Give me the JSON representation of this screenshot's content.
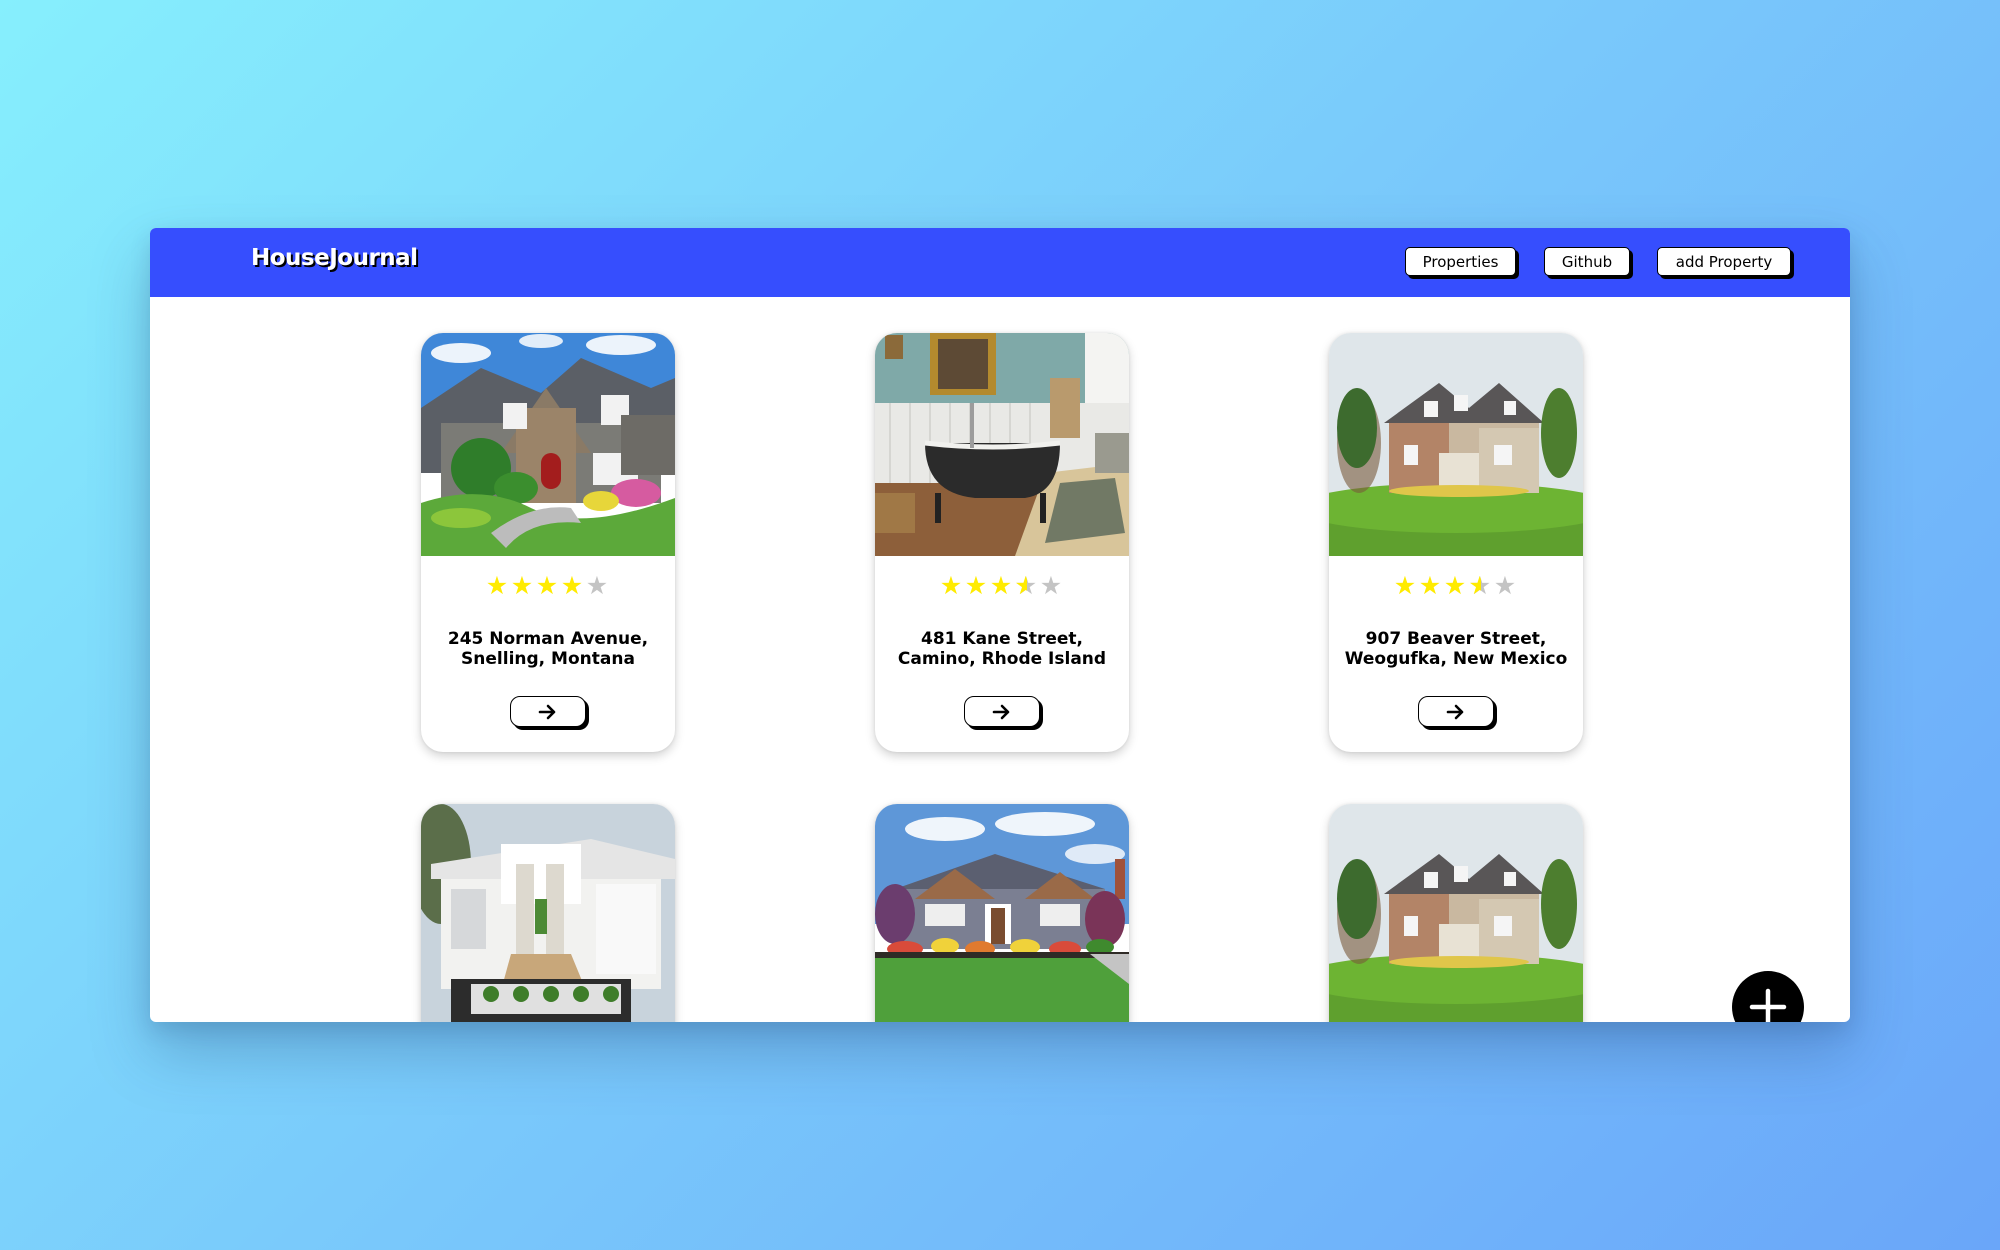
{
  "app": {
    "brand": "HouseJournal"
  },
  "nav": {
    "items": [
      {
        "label": "Properties"
      },
      {
        "label": "Github"
      },
      {
        "label": "add Property"
      }
    ]
  },
  "colors": {
    "navbar": "#364efe",
    "star_filled": "#ffeb00",
    "star_empty": "#c4c4c4",
    "fab": "#000000"
  },
  "properties": [
    {
      "image": "suburban-stone-house-photo",
      "rating": 4,
      "rating_max": 5,
      "address_line1": "245 Norman Avenue,",
      "address_line2": "Snelling, Montana",
      "action_icon": "arrow-right-icon"
    },
    {
      "image": "vintage-bathroom-clawfoot-tub-photo",
      "rating": 3.5,
      "rating_max": 5,
      "address_line1": "481 Kane Street,",
      "address_line2": "Camino, Rhode Island",
      "action_icon": "arrow-right-icon"
    },
    {
      "image": "two-story-brick-house-lawn-photo",
      "rating": 3.5,
      "rating_max": 5,
      "address_line1": "907 Beaver Street,",
      "address_line2": "Weogufka, New Mexico",
      "action_icon": "arrow-right-icon"
    },
    {
      "image": "modern-white-house-photo",
      "rating": null,
      "address_line1": "",
      "address_line2": ""
    },
    {
      "image": "blue-bungalow-garden-photo",
      "rating": null,
      "address_line1": "",
      "address_line2": ""
    },
    {
      "image": "two-story-brick-house-lawn-photo",
      "rating": null,
      "address_line1": "",
      "address_line2": ""
    }
  ],
  "fab": {
    "icon": "plus-icon"
  }
}
